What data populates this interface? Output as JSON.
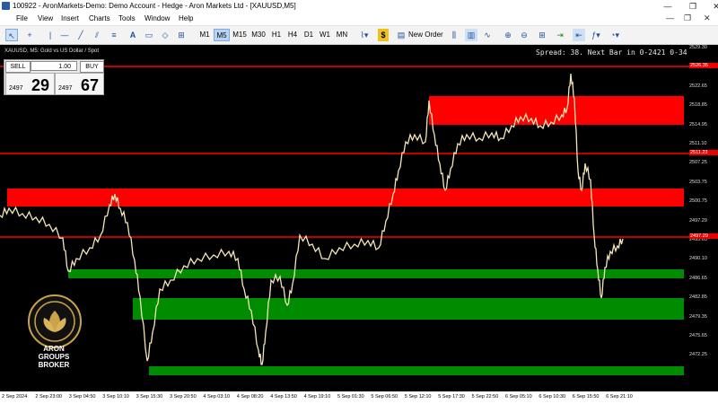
{
  "window": {
    "title": "100922 - AronMarkets-Demo: Demo Account - Hedge - Aron Markets Ltd - [XAUUSD,M5]",
    "controls": [
      "—",
      "❐",
      "✕"
    ]
  },
  "menu": {
    "items": [
      "File",
      "View",
      "Insert",
      "Charts",
      "Tools",
      "Window",
      "Help"
    ],
    "mdi_controls": [
      "—",
      "❐",
      "✕"
    ]
  },
  "toolbar": {
    "timeframes": [
      "M1",
      "M5",
      "M15",
      "M30",
      "H1",
      "H4",
      "D1",
      "W1",
      "MN"
    ],
    "active_timeframe": "M5",
    "new_order_label": "New Order"
  },
  "chart": {
    "symbol_label": "XAUUSD, M5:  Gold vs US Dollar / Spot",
    "spread_text": "Spread: 38. Next Bar in 0-2421 0-34",
    "trade_panel": {
      "sell_label": "SELL",
      "buy_label": "BUY",
      "lot_value": "1.00",
      "bid_prefix": "2497",
      "bid_big": "29",
      "ask_prefix": "2497",
      "ask_big": "67"
    },
    "price_labels": [
      "2529.30",
      "2525.95",
      "2522.65",
      "2518.85",
      "2514.95",
      "2511.10",
      "2507.25",
      "2503.75",
      "2500.75",
      "2497.29",
      "2493.65",
      "2490.10",
      "2486.65",
      "2482.85",
      "2479.35",
      "2475.65",
      "2472.25"
    ],
    "highlighted_prices": [
      "2526.35",
      "2511.23",
      "2497.29"
    ],
    "time_labels": [
      "2 Sep 2024",
      "2 Sep 23:00",
      "3 Sep 04:50",
      "3 Sep 10:10",
      "3 Sep 15:30",
      "3 Sep 20:50",
      "4 Sep 03:10",
      "4 Sep 08:20",
      "4 Sep 13:50",
      "4 Sep 19:10",
      "5 Sep 01:30",
      "5 Sep 06:50",
      "5 Sep 12:10",
      "5 Sep 17:30",
      "5 Sep 22:50",
      "6 Sep 05:10",
      "6 Sep 10:30",
      "6 Sep 15:50",
      "6 Sep 21:10"
    ],
    "colors": {
      "background": "#000000",
      "resistance_zone": "#ff0000",
      "support_zone": "#008c00",
      "price_line": "#ff0000",
      "candles": "#f5e6b8"
    }
  },
  "logo": {
    "line1": "ARON",
    "line2": "GROUPS",
    "line3": "BROKER"
  }
}
